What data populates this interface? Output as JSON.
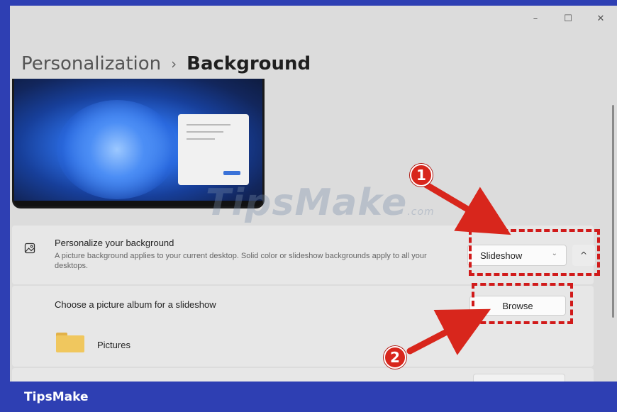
{
  "window": {
    "minimize_glyph": "–",
    "maximize_glyph": "☐",
    "close_glyph": "✕"
  },
  "breadcrumb": {
    "parent": "Personalization",
    "separator": "›",
    "current": "Background"
  },
  "watermark": {
    "text": "TipsMake",
    "suffix": ".com"
  },
  "personalize": {
    "icon": "picture-icon",
    "title": "Personalize your background",
    "description": "A picture background applies to your current desktop. Solid color or slideshow backgrounds apply to all your desktops.",
    "dropdown_value": "Slideshow",
    "expand_glyph": "^"
  },
  "album": {
    "title": "Choose a picture album for a slideshow",
    "browse_label": "Browse",
    "folder_icon": "folder-icon",
    "folder_name": "Pictures"
  },
  "annotations": [
    {
      "number": "1",
      "target": "Slideshow dropdown"
    },
    {
      "number": "2",
      "target": "Browse button"
    }
  ],
  "footer": {
    "brand": "TipsMake"
  },
  "colors": {
    "frame_border": "#2e3fb3",
    "annotation_red": "#d11a1a",
    "accent_blue": "#3a72d8"
  }
}
